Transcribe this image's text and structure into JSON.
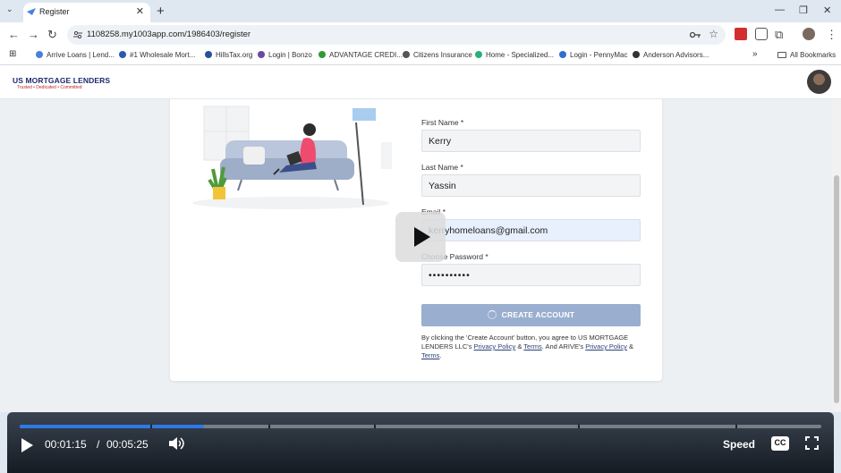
{
  "browser": {
    "tab_title": "Register",
    "url": "1108258.my1003app.com/1986403/register",
    "bookmarks": [
      {
        "label": "Arrive Loans | Lend...",
        "color": "#4a7fe0"
      },
      {
        "label": "#1 Wholesale Mort...",
        "color": "#2a5ab0"
      },
      {
        "label": "HillsTax.org",
        "color": "#2a4f9f"
      },
      {
        "label": "Login | Bonzo",
        "color": "#6a4aa0"
      },
      {
        "label": "ADVANTAGE CREDI...",
        "color": "#2f9a3a"
      },
      {
        "label": "Citizens Insurance",
        "color": "#555555"
      },
      {
        "label": "Home - Specialized...",
        "color": "#2bb07a"
      },
      {
        "label": "Login - PennyMac",
        "color": "#2c6fd0"
      },
      {
        "label": "Anderson Advisors...",
        "color": "#333333"
      }
    ],
    "all_bookmarks": "All Bookmarks"
  },
  "site": {
    "logo_text": "US MORTGAGE LENDERS",
    "logo_tagline": "Trusted • Dedicated • Committed"
  },
  "form": {
    "first_name_label": "First Name *",
    "first_name_value": "Kerry",
    "last_name_label": "Last Name *",
    "last_name_value": "Yassin",
    "email_label": "Email *",
    "email_value": "kerryhomeloans@gmail.com",
    "password_label": "Choose Password *",
    "password_value": "••••••••••",
    "create_button": "CREATE ACCOUNT",
    "consent_1": "By clicking the 'Create Account' button, you agree to US MORTGAGE LENDERS LLC's ",
    "privacy_1": "Privacy Policy",
    "amp_1": " & ",
    "terms_1": "Terms",
    "consent_2": ". And ARIVE's ",
    "privacy_2": "Privacy Policy",
    "amp_2": " & ",
    "terms_2": "Terms",
    "end": "."
  },
  "player": {
    "current_time": "00:01:15",
    "separator": "/",
    "duration": "00:05:25",
    "progress_fraction": 0.23,
    "speed_label": "Speed",
    "cc_label": "CC"
  }
}
